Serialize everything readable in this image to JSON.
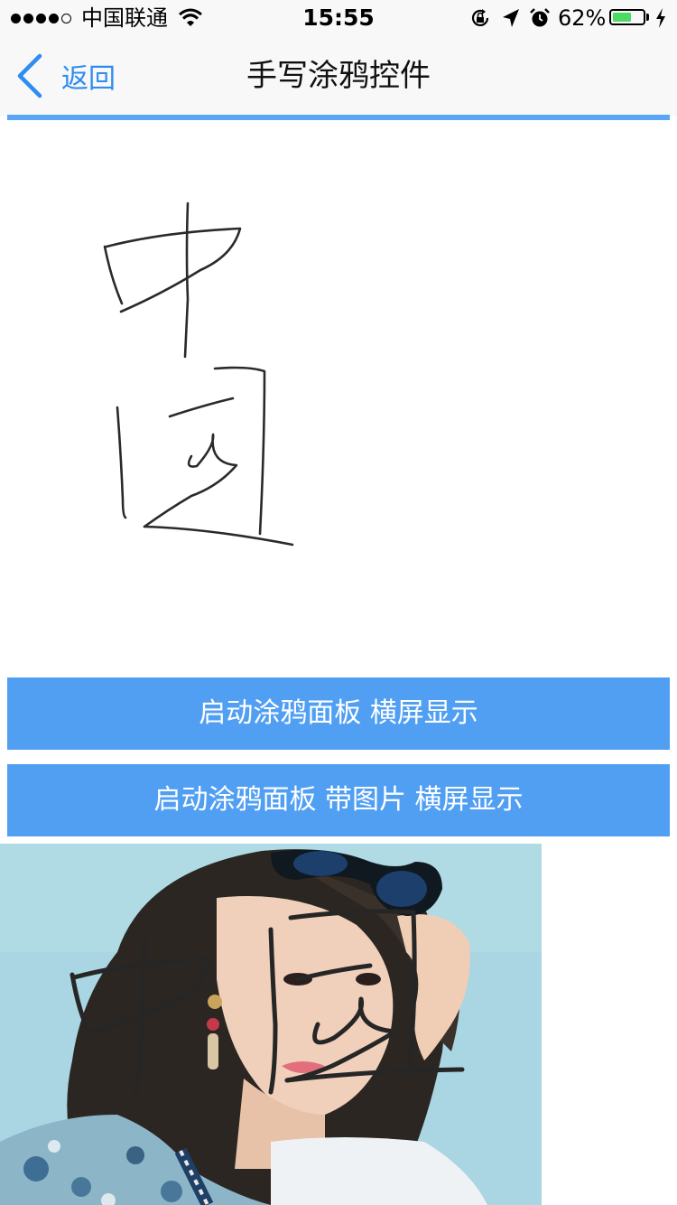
{
  "status_bar": {
    "carrier": "中国联通",
    "time": "15:55",
    "battery_percent": "62%",
    "battery_level": 0.62,
    "signal_bars": 4,
    "signal_total": 5,
    "icons": [
      "wifi-icon",
      "orientation-lock-icon",
      "location-icon",
      "alarm-icon",
      "charging-icon"
    ]
  },
  "nav": {
    "back_label": "返回",
    "title": "手写涂鸦控件"
  },
  "buttons": {
    "landscape": "启动涂鸦面板  横屏显示",
    "with_image_landscape": "启动涂鸦面板 带图片 横屏显示"
  },
  "colors": {
    "accent": "#519ff3",
    "nav_accent_line": "#5aa5f4",
    "back_blue": "#2f8cf0",
    "battery_green": "#4cd964",
    "photo_background": "#a9d6e2"
  }
}
